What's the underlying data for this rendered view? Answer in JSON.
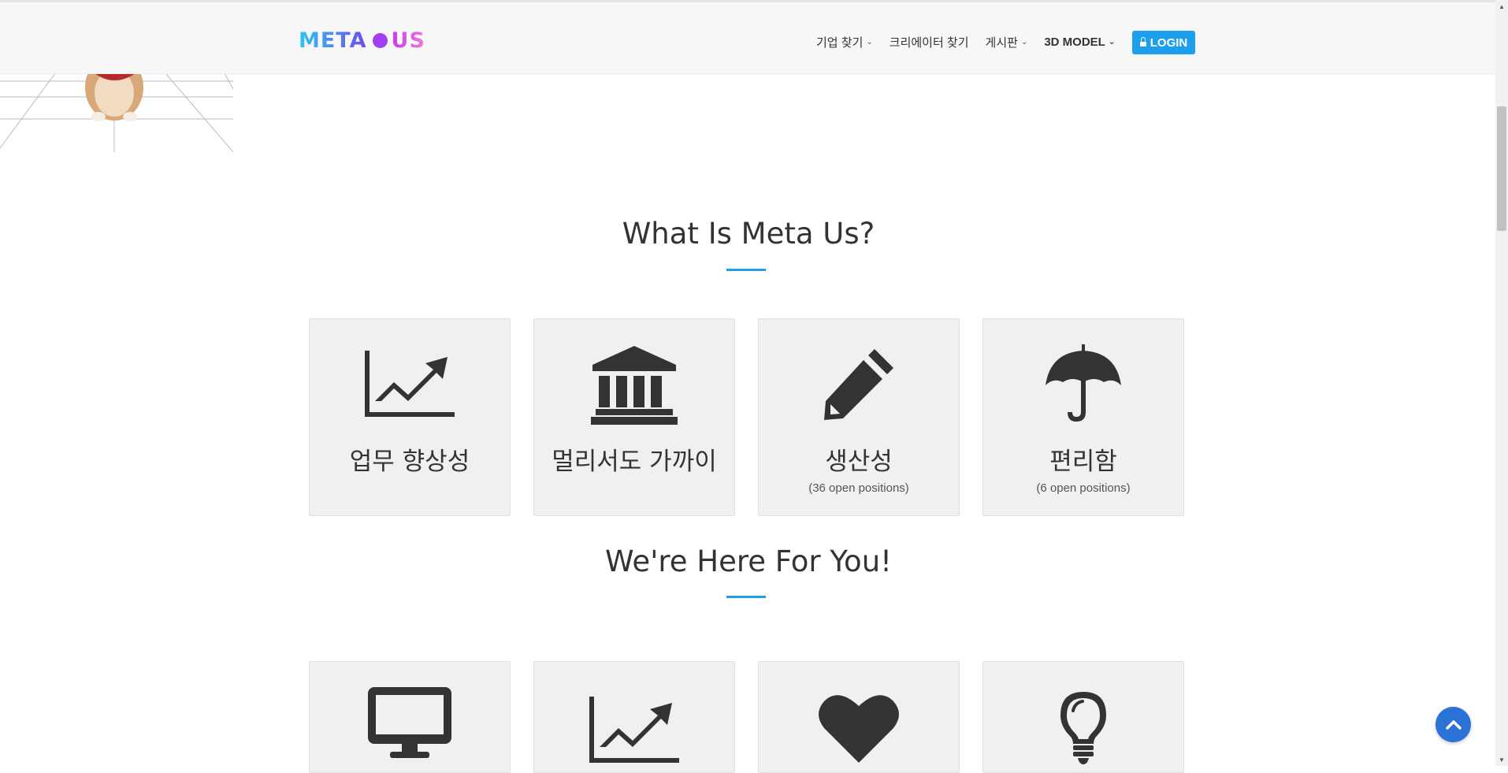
{
  "header": {
    "logo_left": "META",
    "logo_right": "US",
    "nav": [
      {
        "label": "기업 찾기",
        "dropdown": true
      },
      {
        "label": "크리에이터 찾기",
        "dropdown": false
      },
      {
        "label": "게시판",
        "dropdown": true
      },
      {
        "label": "3D MODEL",
        "dropdown": true
      }
    ],
    "login_label": "LOGIN"
  },
  "section1": {
    "title": "What Is Meta Us?",
    "cards": [
      {
        "icon": "line-chart-icon",
        "label": "업무 향상성",
        "sub": ""
      },
      {
        "icon": "bank-icon",
        "label": "멀리서도 가까이",
        "sub": ""
      },
      {
        "icon": "pencil-icon",
        "label": "생산성",
        "sub": "(36 open positions)"
      },
      {
        "icon": "umbrella-icon",
        "label": "편리함",
        "sub": "(6 open positions)"
      }
    ]
  },
  "section2": {
    "title": "We're Here For You!",
    "cards": [
      {
        "icon": "monitor-icon"
      },
      {
        "icon": "line-chart-icon"
      },
      {
        "icon": "heart-icon"
      },
      {
        "icon": "lightbulb-icon"
      }
    ]
  },
  "colors": {
    "accent": "#1e9fee",
    "card_bg": "#f0f0f0",
    "icon": "#333333",
    "back_to_top": "#2a72d6"
  }
}
